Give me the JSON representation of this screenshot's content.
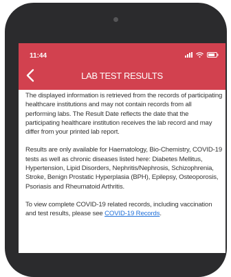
{
  "status_bar": {
    "time": "11:44",
    "icons": [
      "signal-icon",
      "wifi-icon",
      "battery-icon"
    ]
  },
  "header": {
    "title": "LAB TEST RESULTS",
    "back_icon": "chevron-left-icon",
    "color": "#d2414f"
  },
  "content": {
    "paragraph1": "The displayed information is retrieved from the records of participating healthcare institutions and may not contain records from all performing labs. The Result Date reflects the date that the participating healthcare institution receives the lab record and may differ from your printed lab report.",
    "paragraph2": "Results are only available for Haematology, Bio-Chemistry, COVID-19 tests as well as chronic diseases listed here: Diabetes Mellitus, Hypertension, Lipid Disorders, Nephritis/Nephrosis, Schizophrenia, Stroke, Benign Prostatic Hyperplasia (BPH), Epilepsy, Osteoporosis, Psoriasis and Rheumatoid Arthritis.",
    "paragraph3_prefix": "To view complete COVID-19 related records, including vaccination and test results, please see",
    "paragraph3_link": "COVID-19 Records",
    "paragraph3_suffix": ".",
    "link_color": "#1e6fd9"
  }
}
